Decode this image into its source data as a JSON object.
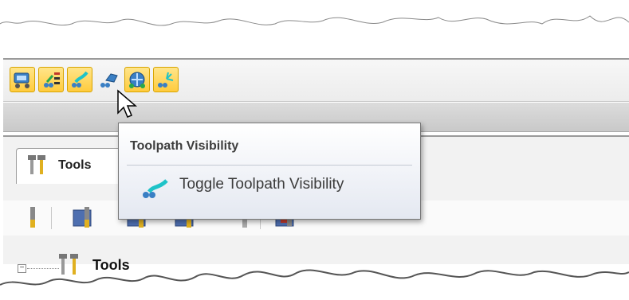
{
  "toolbar": {
    "buttons": [
      {
        "icon": "machine-setup-icon",
        "highlighted": true
      },
      {
        "icon": "toolpath-list-icon",
        "highlighted": true
      },
      {
        "icon": "toolpath-visibility-icon",
        "highlighted": true
      },
      {
        "icon": "toolpath-surface-icon",
        "highlighted": false
      },
      {
        "icon": "toolpath-3d-icon",
        "highlighted": true
      },
      {
        "icon": "toolpath-tree-icon",
        "highlighted": true
      }
    ],
    "highlight_color": "#ffcb3d"
  },
  "panel": {
    "tab_label": "Tools"
  },
  "tree": {
    "root_label": "Tools",
    "expander": "−"
  },
  "tooltip": {
    "title": "Toolpath Visibility",
    "item_label": "Toggle Toolpath Visibility"
  }
}
